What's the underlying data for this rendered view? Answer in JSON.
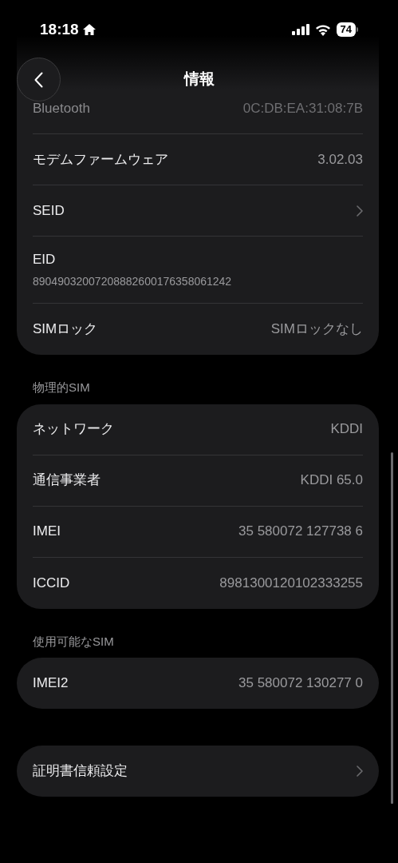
{
  "status_bar": {
    "time": "18:18",
    "battery": "74"
  },
  "header": {
    "title": "情報"
  },
  "sections": [
    {
      "rows": [
        {
          "kind": "value",
          "label": "Bluetooth",
          "value": "0C:DB:EA:31:08:7B",
          "faded": true
        },
        {
          "kind": "value",
          "label": "モデムファームウェア",
          "value": "3.02.03",
          "faded": false
        },
        {
          "kind": "chevron",
          "label": "SEID",
          "faded": false
        },
        {
          "kind": "stacked",
          "label": "EID",
          "value": "89049032007208882600176358061242",
          "faded": false
        },
        {
          "kind": "value",
          "label": "SIMロック",
          "value": "SIMロックなし",
          "faded": false
        }
      ]
    },
    {
      "title": "物理的SIM",
      "rows": [
        {
          "kind": "value",
          "label": "ネットワーク",
          "value": "KDDI",
          "faded": false
        },
        {
          "kind": "value",
          "label": "通信事業者",
          "value": "KDDI 65.0",
          "faded": false
        },
        {
          "kind": "value",
          "label": "IMEI",
          "value": "35 580072 127738 6",
          "faded": false
        },
        {
          "kind": "value",
          "label": "ICCID",
          "value": "8981300120102333255",
          "faded": false
        }
      ]
    },
    {
      "title": "使用可能なSIM",
      "rows": [
        {
          "kind": "value",
          "label": "IMEI2",
          "value": "35 580072 130277 0",
          "faded": false
        }
      ]
    },
    {
      "rows": [
        {
          "kind": "chevron",
          "label": "証明書信頼設定",
          "faded": false
        }
      ]
    }
  ]
}
